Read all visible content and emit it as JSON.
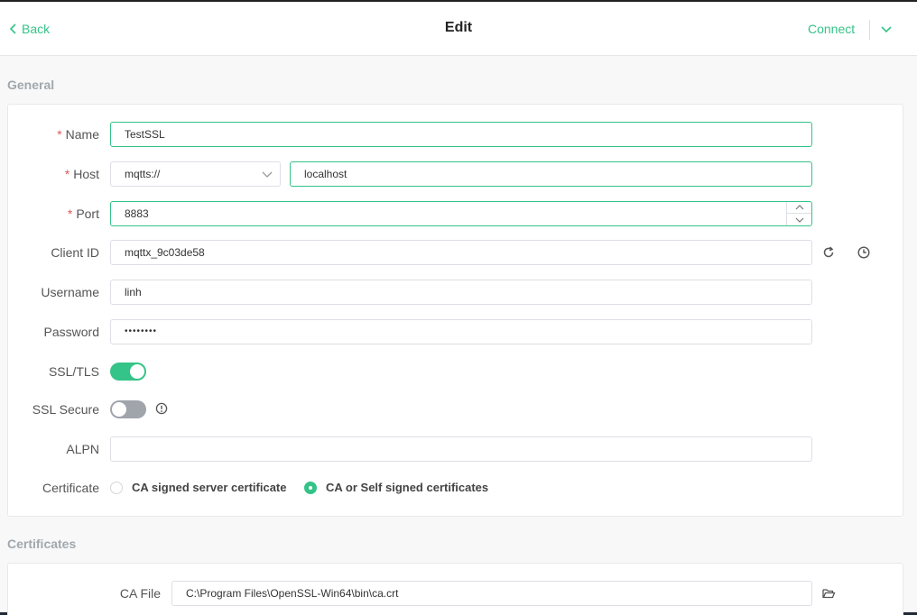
{
  "header": {
    "back_label": "Back",
    "title": "Edit",
    "connect_label": "Connect"
  },
  "general": {
    "section_title": "General",
    "name": {
      "label": "Name",
      "value": "TestSSL"
    },
    "host": {
      "label": "Host",
      "protocol": "mqtts://",
      "value": "localhost"
    },
    "port": {
      "label": "Port",
      "value": "8883"
    },
    "client_id": {
      "label": "Client ID",
      "value": "mqttx_9c03de58"
    },
    "username": {
      "label": "Username",
      "value": "linh"
    },
    "password": {
      "label": "Password",
      "value": "••••••••"
    },
    "ssl_tls": {
      "label": "SSL/TLS",
      "enabled": true
    },
    "ssl_secure": {
      "label": "SSL Secure",
      "enabled": false
    },
    "alpn": {
      "label": "ALPN",
      "value": ""
    },
    "certificate": {
      "label": "Certificate",
      "options": [
        "CA signed server certificate",
        "CA or Self signed certificates"
      ],
      "selected": "CA or Self signed certificates"
    }
  },
  "certificates": {
    "section_title": "Certificates",
    "ca_file": {
      "label": "CA File",
      "value": "C:\\Program Files\\OpenSSL-Win64\\bin\\ca.crt"
    }
  },
  "colors": {
    "accent": "#34c388",
    "required": "#e05a5a",
    "toggle_off": "#a0a4ab"
  },
  "icons": {
    "back": "chevron-left-icon",
    "menu": "chevron-down-icon",
    "refresh": "refresh-icon",
    "history": "clock-icon",
    "info": "info-icon",
    "folder": "folder-open-icon"
  }
}
